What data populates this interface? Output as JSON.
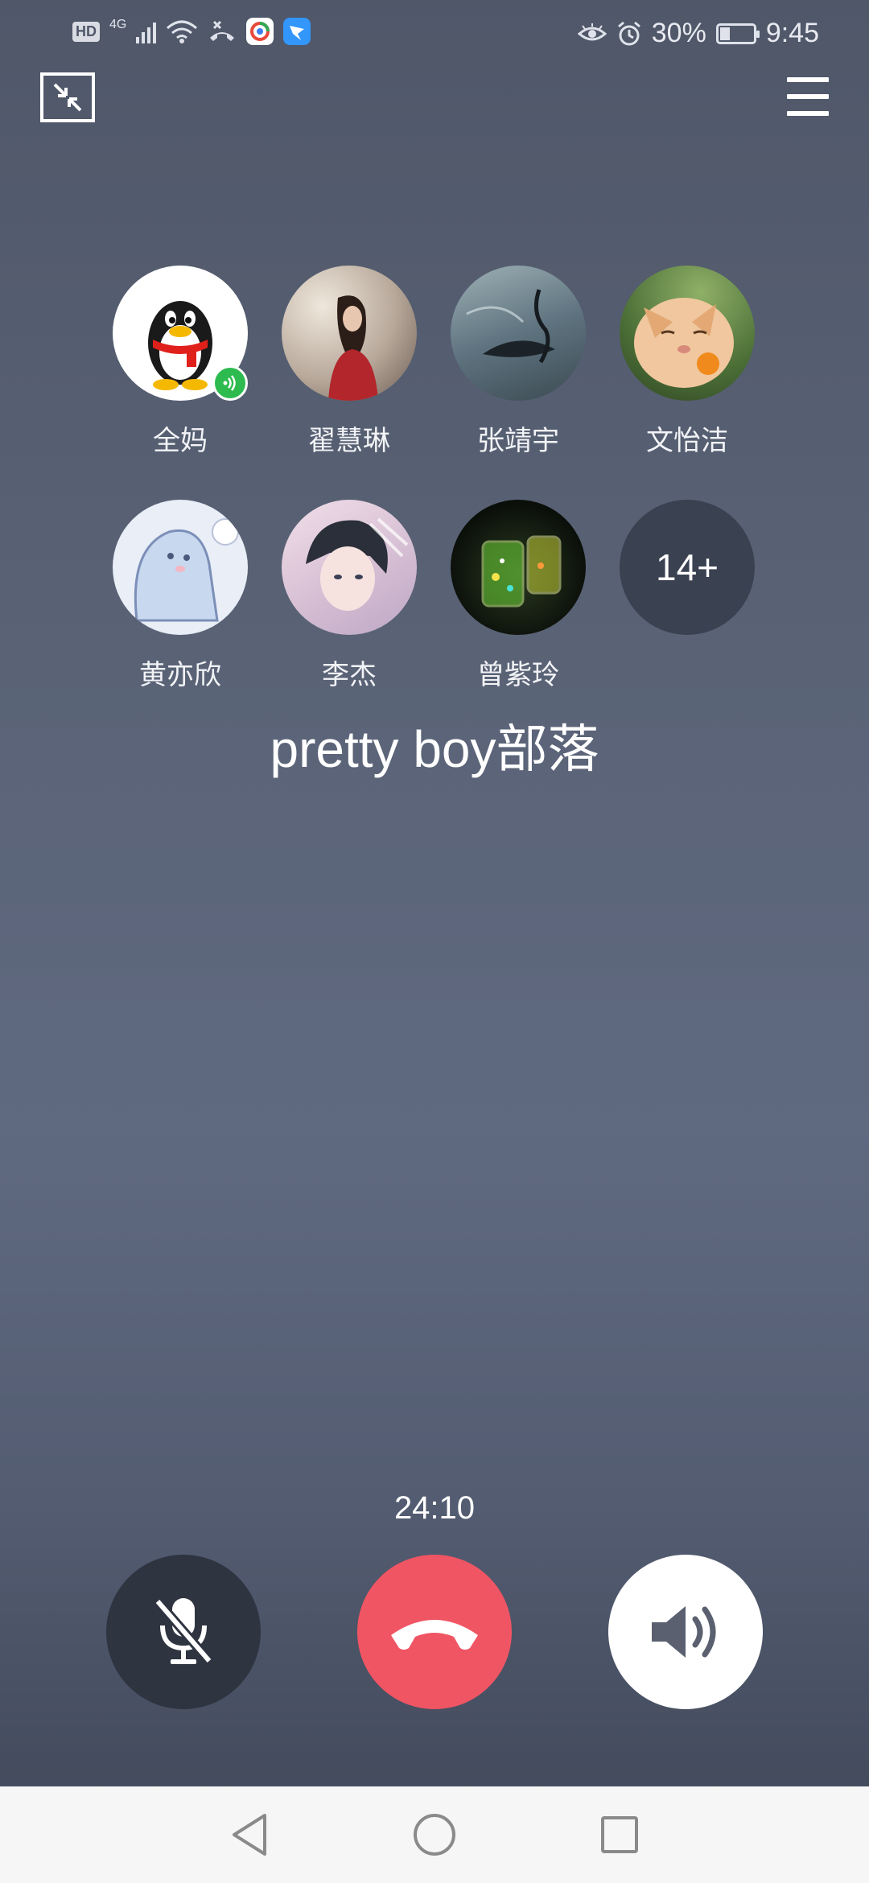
{
  "status_bar": {
    "hd": "HD",
    "network": "4G",
    "battery_percent": "30%",
    "battery_level": 0.3,
    "time": "9:45"
  },
  "call": {
    "members": [
      {
        "name": "全妈",
        "avatar_icon": "penguin-avatar",
        "speaking": true
      },
      {
        "name": "翟慧琳",
        "avatar_icon": "woman-portrait-avatar"
      },
      {
        "name": "张靖宇",
        "avatar_icon": "ink-painting-avatar"
      },
      {
        "name": "文怡洁",
        "avatar_icon": "cat-avatar"
      },
      {
        "name": "黄亦欣",
        "avatar_icon": "cartoon-seal-avatar"
      },
      {
        "name": "李杰",
        "avatar_icon": "anime-boy-avatar"
      },
      {
        "name": "曾紫玲",
        "avatar_icon": "glowing-jars-avatar"
      }
    ],
    "more_count": "14+",
    "group_name": "pretty boy部落",
    "duration": "24:10"
  },
  "colors": {
    "hangup": "#f05564",
    "mute_bg": "#2f3441",
    "speaker_bg": "#ffffff",
    "speaking_badge": "#2dbb4f"
  }
}
